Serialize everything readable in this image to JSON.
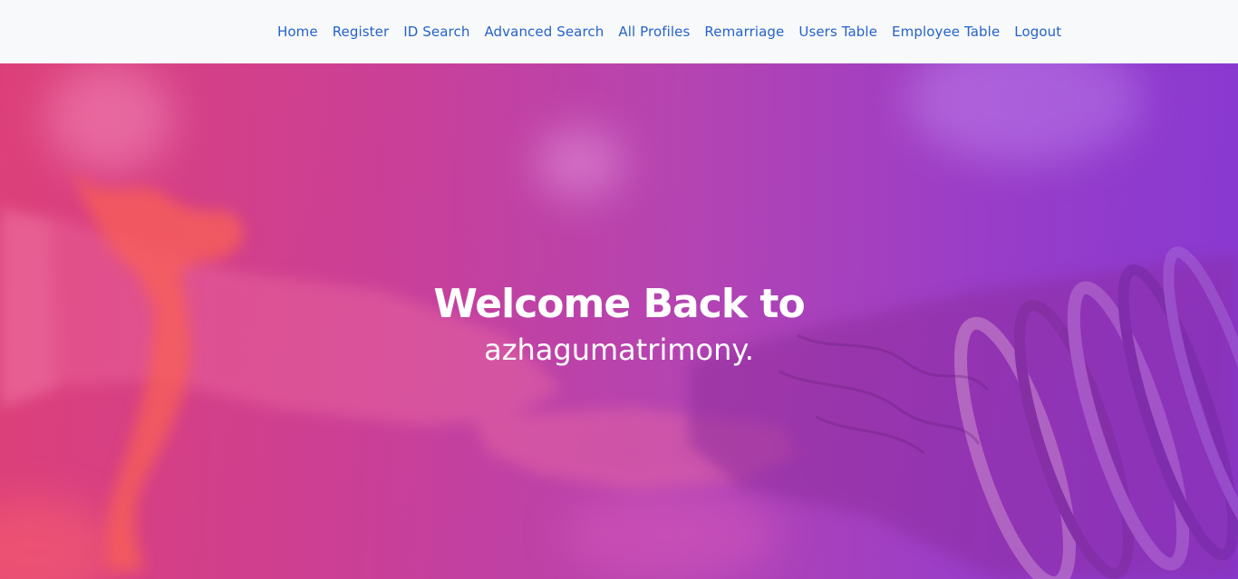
{
  "nav": {
    "items": [
      {
        "label": "Home"
      },
      {
        "label": "Register"
      },
      {
        "label": "ID Search"
      },
      {
        "label": "Advanced Search"
      },
      {
        "label": "All Profiles"
      },
      {
        "label": "Remarriage"
      },
      {
        "label": "Users Table"
      },
      {
        "label": "Employee Table"
      },
      {
        "label": "Logout"
      }
    ]
  },
  "hero": {
    "title": "Welcome Back to",
    "subtitle": "azhagumatrimony."
  },
  "colors": {
    "nav_background": "#f8f9fa",
    "nav_link": "#2563c9",
    "hero_gradient_start": "#d33d7f",
    "hero_gradient_end": "#8c3cd0",
    "hero_text": "#ffffff"
  }
}
